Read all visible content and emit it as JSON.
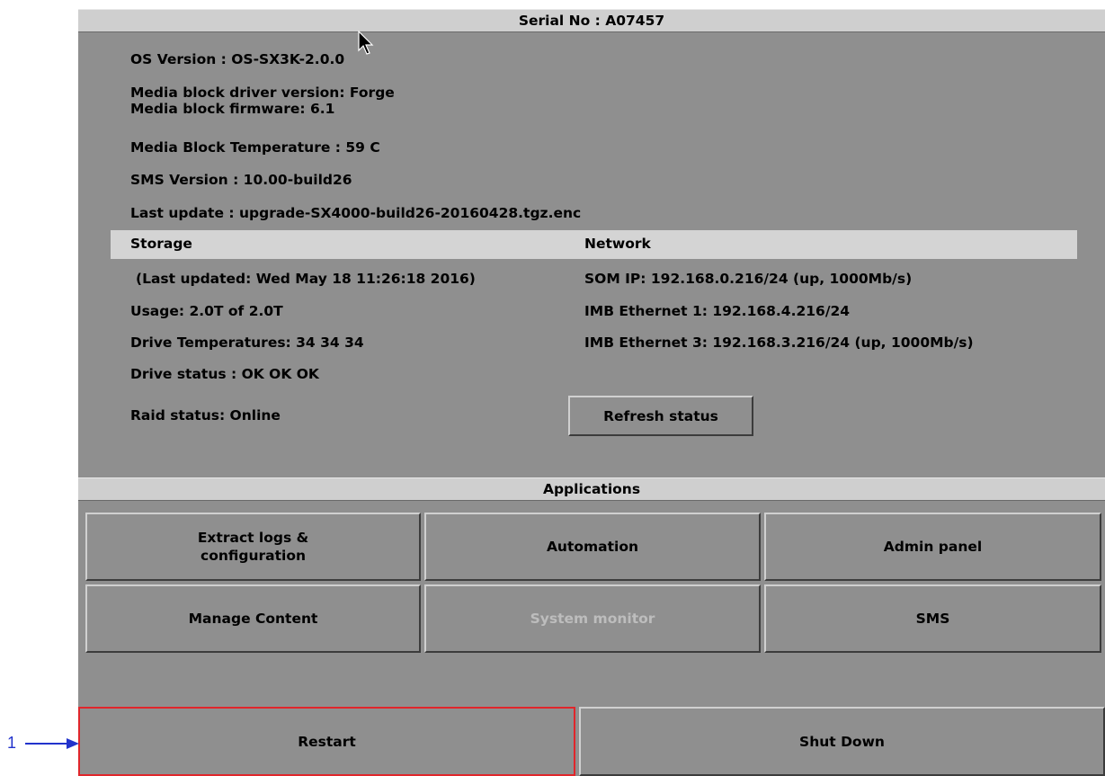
{
  "header": {
    "serial": "Serial No : A07457"
  },
  "system_info": {
    "os_version": "OS Version : OS-SX3K-2.0.0",
    "driver_version": "Media block driver version: Forge",
    "firmware": "Media block firmware: 6.1",
    "temperature": "Media Block Temperature : 59 C",
    "sms_version": "SMS Version : 10.00-build26",
    "last_update": "Last update : upgrade-SX4000-build26-20160428.tgz.enc"
  },
  "storage": {
    "heading": "Storage",
    "last_updated": "(Last updated: Wed May 18 11:26:18 2016)",
    "usage": "Usage: 2.0T of 2.0T",
    "drive_temps": "Drive Temperatures: 34 34 34",
    "drive_status": "Drive status : OK OK OK",
    "raid_status": "Raid status: Online"
  },
  "network": {
    "heading": "Network",
    "som_ip": "SOM IP: 192.168.0.216/24 (up, 1000Mb/s)",
    "imb_eth1": "IMB Ethernet 1: 192.168.4.216/24",
    "imb_eth3": "IMB Ethernet 3: 192.168.3.216/24 (up, 1000Mb/s)"
  },
  "refresh_button": "Refresh status",
  "applications": {
    "heading": "Applications",
    "extract_logs_line1": "Extract logs &",
    "extract_logs_line2": "configuration",
    "automation": "Automation",
    "admin_panel": "Admin panel",
    "manage_content": "Manage Content",
    "system_monitor": "System monitor",
    "sms": "SMS"
  },
  "power": {
    "restart": "Restart",
    "shutdown": "Shut Down"
  },
  "annotation": {
    "number": "1",
    "arrow": "⟶"
  },
  "colors": {
    "highlight": "#e0262b",
    "annotation": "#2233cc",
    "panel": "#8f8f8f"
  }
}
